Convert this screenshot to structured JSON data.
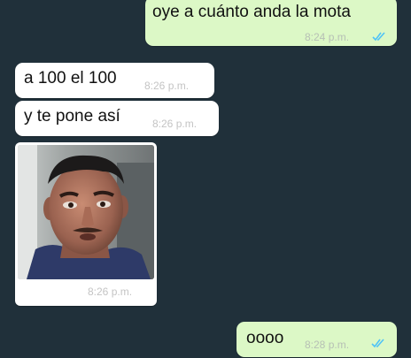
{
  "conversation": {
    "messages": [
      {
        "direction": "outgoing",
        "text": "oye a cuánto anda la mota",
        "time": "8:24 p.m.",
        "status": "read"
      },
      {
        "direction": "incoming",
        "text": "a 100 el 100",
        "time": "8:26 p.m."
      },
      {
        "direction": "incoming",
        "text": "y te pone así",
        "time": "8:26 p.m."
      },
      {
        "direction": "incoming",
        "type": "image",
        "image_subject": "man-face-photo",
        "time": "8:26 p.m."
      },
      {
        "direction": "outgoing",
        "text": "oooo",
        "time": "8:28 p.m.",
        "status": "read"
      }
    ]
  },
  "colors": {
    "background": "#20303a",
    "outgoing_bubble": "#dcf8c6",
    "incoming_bubble": "#ffffff",
    "read_ticks": "#4fc3f7"
  }
}
